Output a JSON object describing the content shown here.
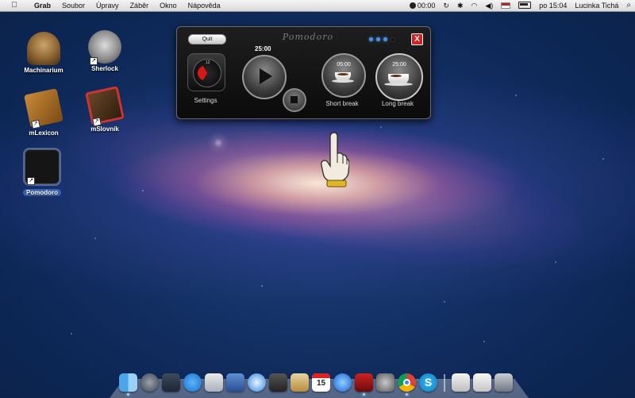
{
  "menubar": {
    "apple": "",
    "app_name": "Grab",
    "items": [
      "Soubor",
      "Úpravy",
      "Záběr",
      "Okno",
      "Nápověda"
    ],
    "timer": "00:00",
    "datetime": "po 15:04",
    "user": "Lucinka Tichá"
  },
  "desktop_icons": {
    "machinarium": "Machinarium",
    "sherlock": "Sherlock",
    "mlexicon": "mLexicon",
    "mslovnik": "mSlovník",
    "pomodoro": "Pomodoro"
  },
  "widget": {
    "title": "Pomodoro",
    "quit": "Quit",
    "close": "X",
    "settings_label": "Settings",
    "clock_12": "12",
    "main_time": "25:00",
    "short_break_time": "05:00",
    "short_break_label": "Short break",
    "long_break_time": "25:00",
    "long_break_label": "Long break",
    "progress_dots_total": 4,
    "progress_dots_done": 3
  },
  "dock": {
    "calendar_day": "15",
    "skype_letter": "S"
  },
  "colors": {
    "accent_blue": "#4a92e6",
    "close_red": "#d42020",
    "widget_bg": "#111111"
  }
}
